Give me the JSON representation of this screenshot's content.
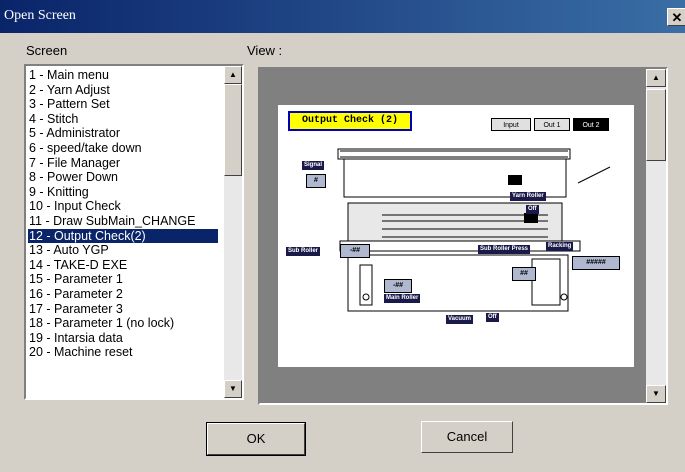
{
  "window": {
    "title": "Open Screen",
    "close_label": "✕"
  },
  "screen_label": "Screen",
  "view_label": "View :",
  "screens": [
    "1 - Main menu",
    "2 - Yarn Adjust",
    "3 - Pattern Set",
    "4 - Stitch",
    "5 - Administrator",
    "6 - speed/take down",
    "7 - File Manager",
    "8 - Power Down",
    "9 - Knitting",
    "10 - Input Check",
    "11 - Draw SubMain_CHANGE",
    "12 - Output Check(2)",
    "13 - Auto YGP",
    "14 - TAKE-D  EXE",
    "15 - Parameter 1",
    "16 - Parameter 2",
    "17 - Parameter 3",
    "18 - Parameter 1 (no lock)",
    "19 - Intarsia data",
    "20 - Machine reset"
  ],
  "selected_index": 11,
  "preview": {
    "title": "Output Check (2)",
    "tabs": [
      "Input",
      "Out 1",
      "Out 2"
    ],
    "active_tab": 2,
    "labels": {
      "signal": "Signal",
      "signal_value": "#",
      "yarn_roller": "Yarn Roller",
      "yarn_roller_value": "Off",
      "sub_roller": "Sub Roller",
      "sub_roller_value": "-##",
      "sub_roller_press": "Sub Roller Press",
      "sub_roller_press_value": "##",
      "racking": "Racking",
      "racking_value": "#####",
      "main_roller": "Main Roller",
      "main_roller_value": "-##",
      "vacuum": "Vacuum",
      "vacuum_value": "Off"
    }
  },
  "buttons": {
    "ok": "OK",
    "cancel": "Cancel"
  }
}
